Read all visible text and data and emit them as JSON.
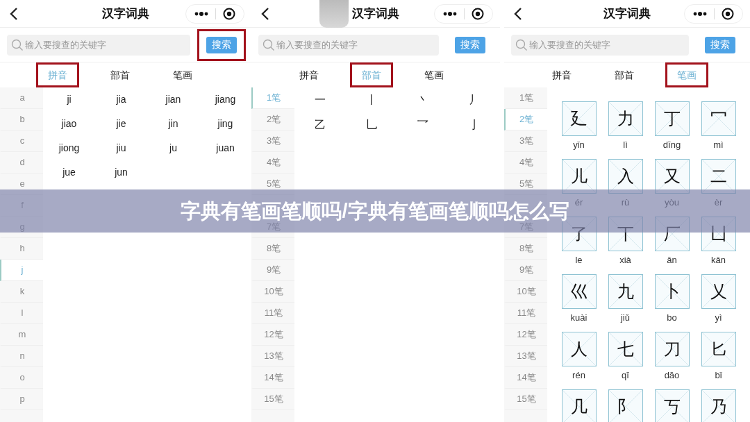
{
  "panels": [
    {
      "kind": "syllables",
      "title": "汉字词典",
      "search": {
        "placeholder": "输入要搜查的关键字",
        "button": "搜索",
        "highlighted": true
      },
      "tabs": [
        {
          "label": "拼音",
          "selected": true,
          "highlighted": true
        },
        {
          "label": "部首",
          "selected": false,
          "highlighted": false
        },
        {
          "label": "笔画",
          "selected": false,
          "highlighted": false
        }
      ],
      "index": [
        {
          "label": "a",
          "selected": false
        },
        {
          "label": "b",
          "selected": false
        },
        {
          "label": "c",
          "selected": false
        },
        {
          "label": "d",
          "selected": false
        },
        {
          "label": "e",
          "selected": false
        },
        {
          "label": "f",
          "selected": false
        },
        {
          "label": "g",
          "selected": false
        },
        {
          "label": "h",
          "selected": false
        },
        {
          "label": "j",
          "selected": true
        },
        {
          "label": "k",
          "selected": false
        },
        {
          "label": "l",
          "selected": false
        },
        {
          "label": "m",
          "selected": false
        },
        {
          "label": "n",
          "selected": false
        },
        {
          "label": "o",
          "selected": false
        },
        {
          "label": "p",
          "selected": false
        }
      ],
      "items": [
        {
          "text": "ji"
        },
        {
          "text": "jia"
        },
        {
          "text": "jian"
        },
        {
          "text": "jiang"
        },
        {
          "text": "jiao"
        },
        {
          "text": "jie"
        },
        {
          "text": "jin"
        },
        {
          "text": "jing"
        },
        {
          "text": "jiong"
        },
        {
          "text": "jiu"
        },
        {
          "text": "ju"
        },
        {
          "text": "juan"
        },
        {
          "text": "jue"
        },
        {
          "text": "jun"
        }
      ]
    },
    {
      "kind": "strokes",
      "title": "汉字词典",
      "search": {
        "placeholder": "输入要搜查的关键字",
        "button": "搜索",
        "highlighted": false
      },
      "tabs": [
        {
          "label": "拼音",
          "selected": false,
          "highlighted": false
        },
        {
          "label": "部首",
          "selected": true,
          "highlighted": true
        },
        {
          "label": "笔画",
          "selected": false,
          "highlighted": false
        }
      ],
      "index": [
        {
          "kind": "label",
          "label": "1笔",
          "selected": true
        },
        {
          "kind": "label",
          "label": "2笔",
          "selected": false
        },
        {
          "kind": "label",
          "label": "3笔",
          "selected": false
        },
        {
          "kind": "label",
          "label": "4笔",
          "selected": false
        },
        {
          "kind": "label",
          "label": "5笔",
          "selected": false
        },
        {
          "kind": "covered"
        },
        {
          "kind": "label",
          "label": "7笔",
          "selected": false
        },
        {
          "kind": "label",
          "label": "8笔",
          "selected": false
        },
        {
          "kind": "label",
          "label": "9笔",
          "selected": false
        },
        {
          "kind": "label",
          "label": "10笔",
          "selected": false
        },
        {
          "kind": "label",
          "label": "11笔",
          "selected": false
        },
        {
          "kind": "label",
          "label": "12笔",
          "selected": false
        },
        {
          "kind": "label",
          "label": "13笔",
          "selected": false
        },
        {
          "kind": "label",
          "label": "14笔",
          "selected": false
        },
        {
          "kind": "label",
          "label": "15笔",
          "selected": false
        }
      ],
      "items": [
        {
          "text": "一"
        },
        {
          "text": "丨"
        },
        {
          "text": "丶"
        },
        {
          "text": "丿"
        },
        {
          "text": "乙"
        },
        {
          "text": "乚"
        },
        {
          "text": "乛"
        },
        {
          "text": "亅"
        }
      ]
    },
    {
      "kind": "characters",
      "title": "汉字词典",
      "search": {
        "placeholder": "输入要搜查的关键字",
        "button": "搜索",
        "highlighted": false
      },
      "tabs": [
        {
          "label": "拼音",
          "selected": false,
          "highlighted": false
        },
        {
          "label": "部首",
          "selected": false,
          "highlighted": false
        },
        {
          "label": "笔画",
          "selected": true,
          "highlighted": true
        }
      ],
      "index": [
        {
          "kind": "label",
          "label": "1笔",
          "selected": false
        },
        {
          "kind": "label",
          "label": "2笔",
          "selected": true
        },
        {
          "kind": "label",
          "label": "3笔",
          "selected": false
        },
        {
          "kind": "label",
          "label": "4笔",
          "selected": false
        },
        {
          "kind": "label",
          "label": "5笔",
          "selected": false
        },
        {
          "kind": "covered"
        },
        {
          "kind": "label",
          "label": "7笔",
          "selected": false
        },
        {
          "kind": "label",
          "label": "8笔",
          "selected": false
        },
        {
          "kind": "label",
          "label": "9笔",
          "selected": false
        },
        {
          "kind": "label",
          "label": "10笔",
          "selected": false
        },
        {
          "kind": "label",
          "label": "11笔",
          "selected": false
        },
        {
          "kind": "label",
          "label": "12笔",
          "selected": false
        },
        {
          "kind": "label",
          "label": "13笔",
          "selected": false
        },
        {
          "kind": "label",
          "label": "14笔",
          "selected": false
        },
        {
          "kind": "label",
          "label": "15笔",
          "selected": false
        }
      ],
      "items": [
        {
          "text": "廴",
          "pinyin": "yǐn"
        },
        {
          "text": "力",
          "pinyin": "lì"
        },
        {
          "text": "丁",
          "pinyin": "dīng"
        },
        {
          "text": "冖",
          "pinyin": "mì"
        },
        {
          "text": "儿",
          "pinyin": "ér"
        },
        {
          "text": "入",
          "pinyin": "rù"
        },
        {
          "text": "又",
          "pinyin": "yòu"
        },
        {
          "text": "二",
          "pinyin": "èr"
        },
        {
          "text": "了",
          "pinyin": "le"
        },
        {
          "text": "丅",
          "pinyin": "xià"
        },
        {
          "text": "厂",
          "pinyin": "ān"
        },
        {
          "text": "凵",
          "pinyin": "kǎn"
        },
        {
          "text": "巛",
          "pinyin": "kuài"
        },
        {
          "text": "九",
          "pinyin": "jiǔ"
        },
        {
          "text": "卜",
          "pinyin": "bo"
        },
        {
          "text": "乂",
          "pinyin": "yì"
        },
        {
          "text": "人",
          "pinyin": "rén"
        },
        {
          "text": "七",
          "pinyin": "qī"
        },
        {
          "text": "刀",
          "pinyin": "dāo"
        },
        {
          "text": "匕",
          "pinyin": "bǐ"
        },
        {
          "text": "几"
        },
        {
          "text": "阝"
        },
        {
          "text": "丂"
        },
        {
          "text": "乃"
        }
      ]
    }
  ],
  "banner": {
    "text": "字典有笔画笔顺吗/字典有笔画笔顺吗怎么写"
  }
}
